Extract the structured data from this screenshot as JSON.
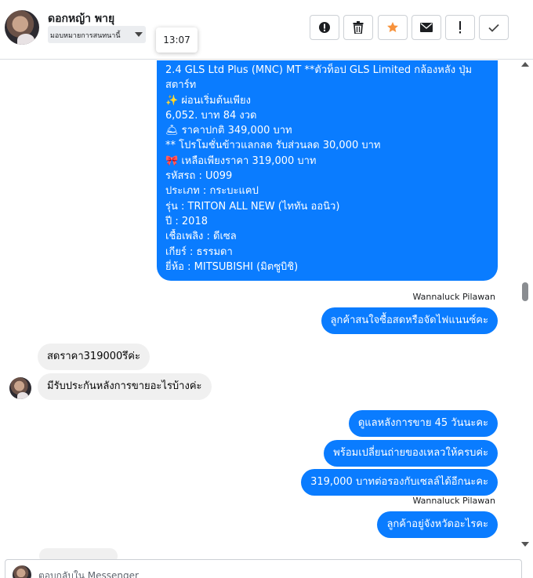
{
  "header": {
    "contact_name": "ดอกหญ้า พายุ",
    "assign_label": "มอบหมายการสนทนานี้",
    "tooltip_time": "13:07",
    "toolbar": [
      {
        "name": "mark-spam-button",
        "icon": "alert-circle-icon"
      },
      {
        "name": "delete-button",
        "icon": "trash-icon"
      },
      {
        "name": "star-button",
        "icon": "star-icon",
        "color": "#f7923b"
      },
      {
        "name": "mark-unread-button",
        "icon": "envelope-icon"
      },
      {
        "name": "follow-up-button",
        "icon": "exclamation-icon"
      },
      {
        "name": "mark-done-button",
        "icon": "checkmark-icon"
      }
    ]
  },
  "conversation": {
    "big_message_lines": [
      "2.4 GLS Ltd Plus (MNC) MT **ตัวท็อป GLS Limited กล้องหลัง ปุ่ม",
      "สตาร์ท",
      "✨ ผ่อนเริ่มต้นเพียง",
      "6,052. บาท 84 งวด",
      "🛎 ราคาปกติ 349,000 บาท",
      "** โปรโมชั่นข้าวแลกลด รับส่วนลด 30,000 บาท",
      "🎀 เหลือเพียงราคา 319,000 บาท",
      "รหัสรถ : U099",
      "ประเภท : กระบะแคป",
      "รุ่น : TRITON ALL NEW (ไททัน ออนิว)",
      "ปี : 2018",
      "เชื้อเพลิง : ดีเซล",
      "เกียร์ : ธรรมดา",
      "ยี่ห้อ : MITSUBISHI (มิตซูบิชิ)"
    ],
    "sender_1": "Wannaluck Pilawan",
    "msg_out_1": "ลูกค้าสนใจซื้อสดหรือจัดไฟแนนซ์คะ",
    "msg_in_1": "สดราคา319000รึค่ะ",
    "msg_in_2": "มีรับประกันหลังการขายอะไรบ้างค่ะ",
    "msg_out_2": "ดูแลหลังการขาย 45 วันนะคะ",
    "msg_out_3": "พร้อมเปลี่ยนถ่ายของเหลวให้ครบค่ะ",
    "msg_out_4": "319,000  บาทต่อรองกับเซลล์ได้อีกนะคะ",
    "sender_2": "Wannaluck Pilawan",
    "msg_out_5": "ลูกค้าอยู่จังหวัดอะไรคะ"
  },
  "composer": {
    "placeholder": "ตอบกลับใน Messenger"
  },
  "colors": {
    "outgoing_bubble": "#0a7cff",
    "incoming_bubble": "#f0f0f0",
    "star": "#f7923b"
  }
}
